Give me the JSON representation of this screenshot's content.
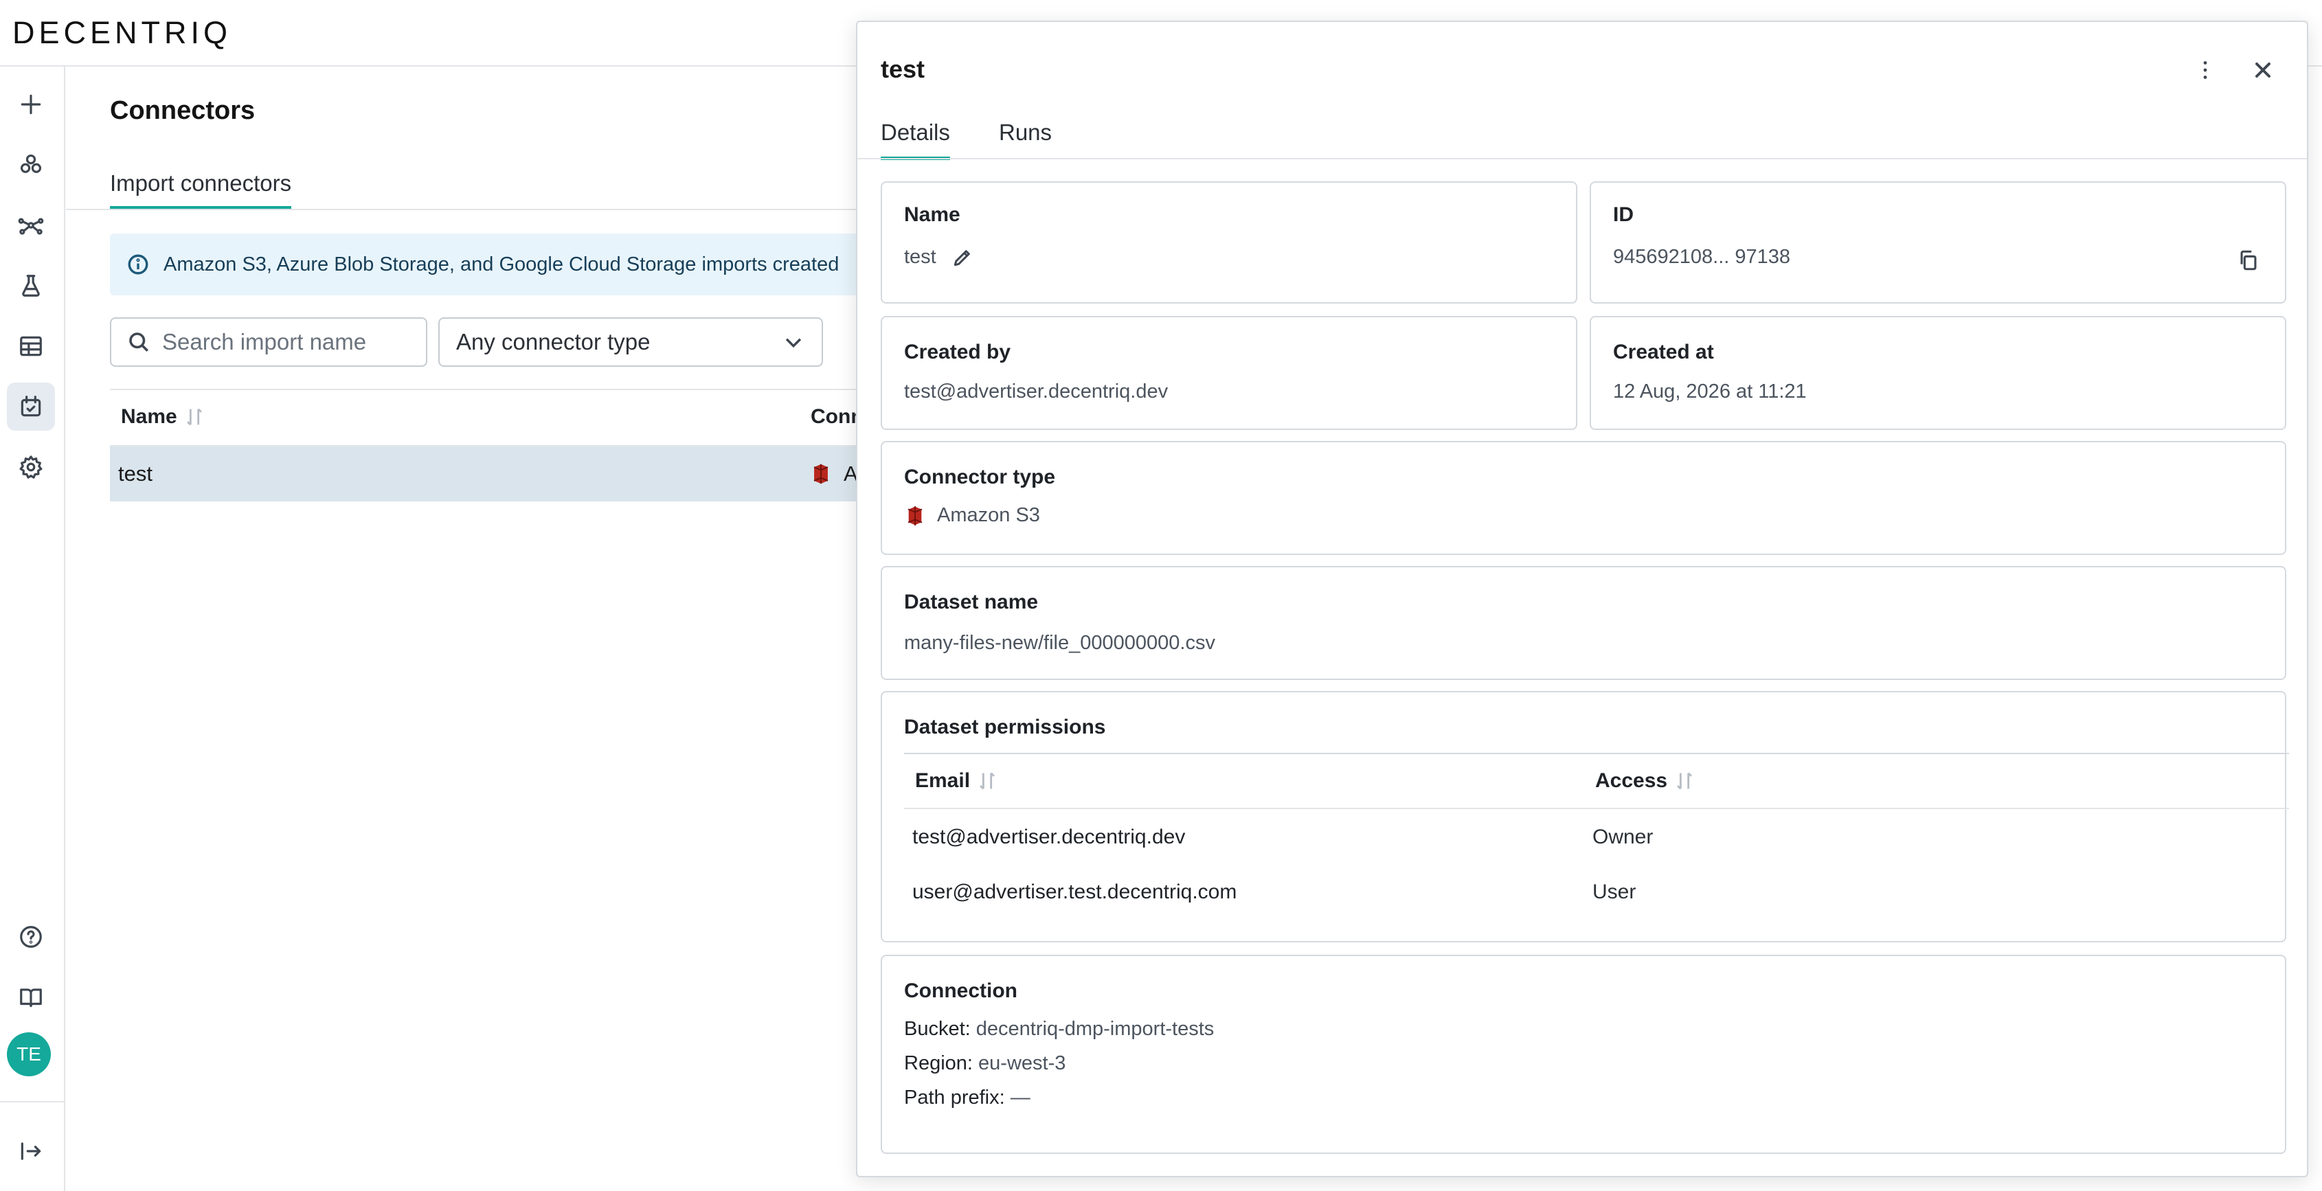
{
  "app": {
    "logo_text": "DECENTRIQ"
  },
  "rail": {
    "items": [
      {
        "icon": "plus-icon"
      },
      {
        "icon": "clean-rooms-icon"
      },
      {
        "icon": "network-icon"
      },
      {
        "icon": "flask-icon"
      },
      {
        "icon": "table-icon"
      },
      {
        "icon": "connectors-icon",
        "active": true
      },
      {
        "icon": "gear-icon"
      }
    ],
    "bottom": [
      {
        "icon": "help-icon"
      },
      {
        "icon": "book-icon"
      }
    ],
    "avatar_initials": "TE",
    "collapse_icon": "collapse-icon"
  },
  "page": {
    "title": "Connectors",
    "subtab": "Import connectors",
    "banner": "Amazon S3, Azure Blob Storage, and Google Cloud Storage imports created",
    "search_placeholder": "Search import name",
    "type_filter": "Any connector type",
    "columns": {
      "name": "Name",
      "connector": "Conn"
    },
    "rows": [
      {
        "name": "test",
        "connector": "Ar"
      }
    ]
  },
  "drawer": {
    "title": "test",
    "tabs": [
      {
        "label": "Details",
        "active": true
      },
      {
        "label": "Runs",
        "active": false
      }
    ],
    "name": {
      "label": "Name",
      "value": "test"
    },
    "id": {
      "label": "ID",
      "value": "945692108... 97138"
    },
    "created_by": {
      "label": "Created by",
      "value": "test@advertiser.decentriq.dev"
    },
    "created_at": {
      "label": "Created at",
      "value": "12 Aug, 2026 at 11:21"
    },
    "connector_type": {
      "label": "Connector type",
      "value": "Amazon S3"
    },
    "dataset_name": {
      "label": "Dataset name",
      "value": "many-files-new/file_000000000.csv"
    },
    "permissions": {
      "label": "Dataset permissions",
      "columns": {
        "email": "Email",
        "access": "Access"
      },
      "rows": [
        {
          "email": "test@advertiser.decentriq.dev",
          "access": "Owner"
        },
        {
          "email": "user@advertiser.test.decentriq.com",
          "access": "User"
        }
      ]
    },
    "connection": {
      "label": "Connection",
      "bucket_label": "Bucket:",
      "bucket": "decentriq-dmp-import-tests",
      "region_label": "Region:",
      "region": "eu-west-3",
      "prefix_label": "Path prefix:",
      "prefix": "—"
    }
  },
  "colors": {
    "accent": "#14a99a",
    "selected_row": "#d9e4ec",
    "banner_bg": "#e8f4fb",
    "s3_red": "#b8261d"
  }
}
